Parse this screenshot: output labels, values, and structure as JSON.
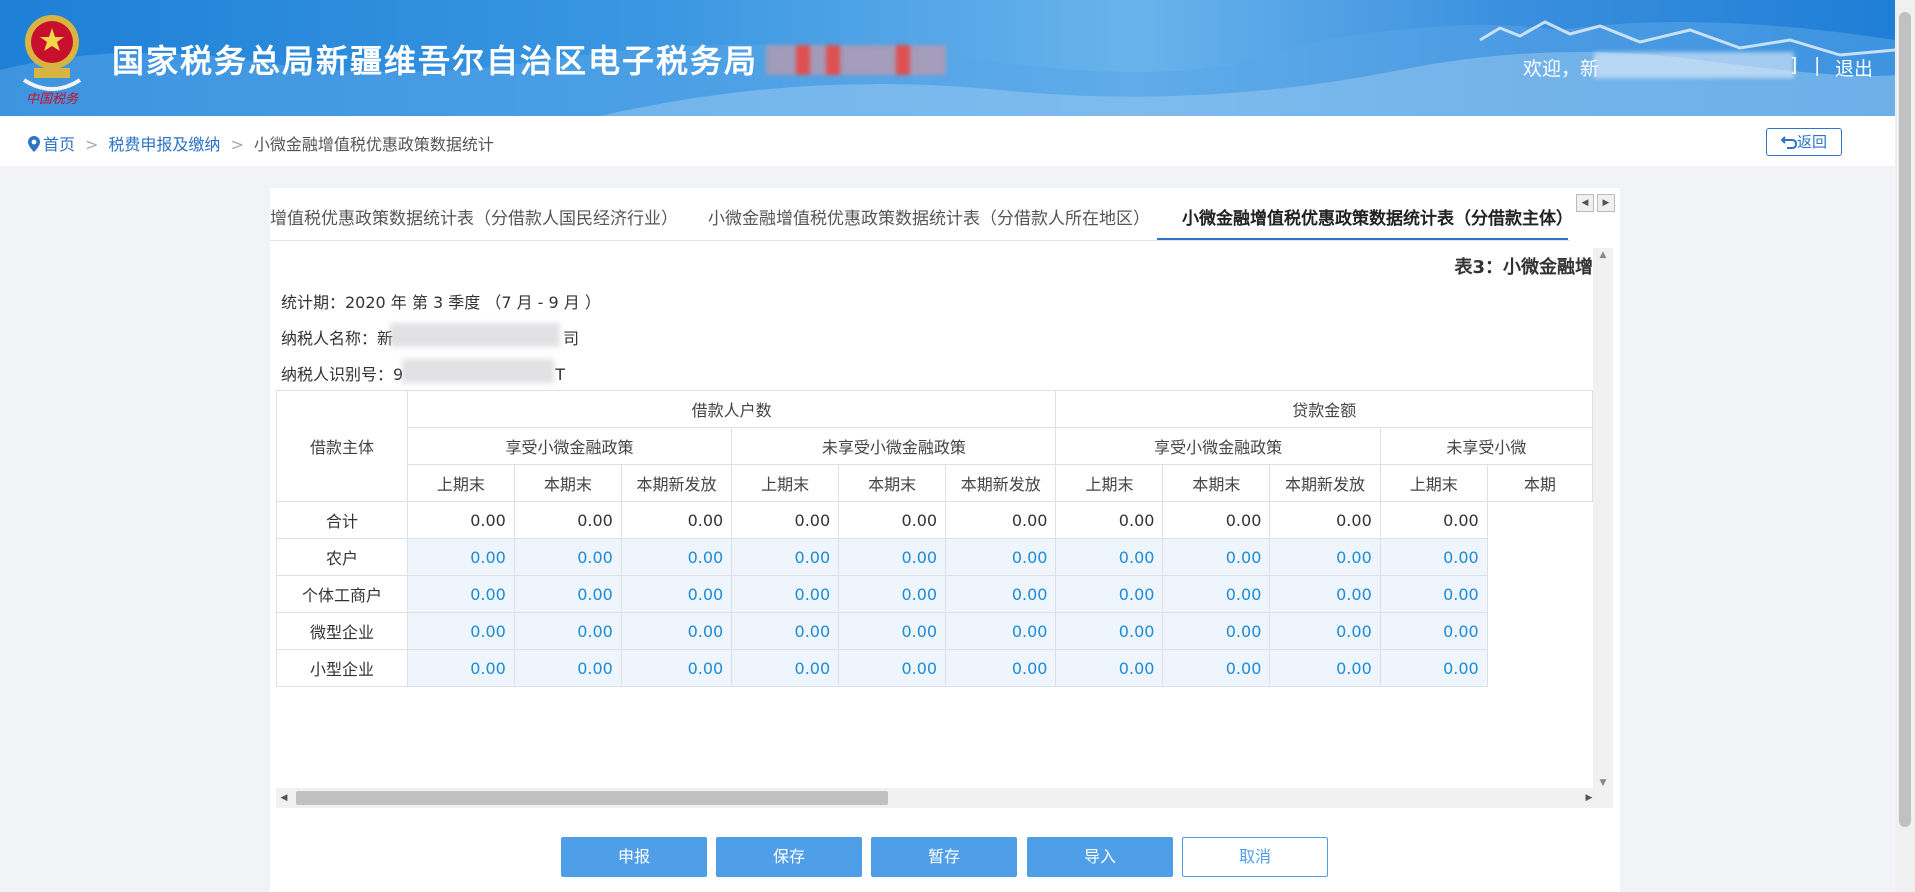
{
  "header": {
    "site_title": "国家税务总局新疆维吾尔自治区电子税务局",
    "welcome": "欢迎，新",
    "welcome_tail": "]",
    "separator": "|",
    "logout": "退出",
    "emblem_caption": "中国税务"
  },
  "breadcrumb": {
    "home": "首页",
    "level1": "税费申报及缴纳",
    "current": "小微金融增值税优惠政策数据统计",
    "separator": ">"
  },
  "back_button": "返回",
  "tabs": [
    {
      "label": "增值税优惠政策数据统计表（分借款人国民经济行业）",
      "active": false
    },
    {
      "label": "小微金融增值税优惠政策数据统计表（分借款人所在地区）",
      "active": false
    },
    {
      "label": "小微金融增值税优惠政策数据统计表（分借款主体）",
      "active": true
    }
  ],
  "form": {
    "table_title": "表3：小微金融增",
    "period": "统计期：2020 年 第 3 季度 （7 月 - 9 月 ）",
    "taxpayer_name_label": "纳税人名称：",
    "taxpayer_name_start": "新",
    "taxpayer_name_end": "司",
    "taxpayer_id_label": "纳税人识别号：",
    "taxpayer_id_start": "9",
    "taxpayer_id_end": "T"
  },
  "table": {
    "row_header": "借款主体",
    "group1": "借款人户数",
    "group2": "贷款金额",
    "sub_enjoy": "享受小微金融政策",
    "sub_not": "未享受小微金融政策",
    "sub_not_cut": "未享受小微",
    "col_prev": "上期末",
    "col_cur": "本期末",
    "col_new": "本期新发放",
    "col_cur_cut": "本期",
    "rows": [
      {
        "label": "合计",
        "values": [
          "0.00",
          "0.00",
          "0.00",
          "0.00",
          "0.00",
          "0.00",
          "0.00",
          "0.00",
          "0.00",
          "0.00"
        ]
      },
      {
        "label": "农户",
        "values": [
          "0.00",
          "0.00",
          "0.00",
          "0.00",
          "0.00",
          "0.00",
          "0.00",
          "0.00",
          "0.00",
          "0.00"
        ]
      },
      {
        "label": "个体工商户",
        "values": [
          "0.00",
          "0.00",
          "0.00",
          "0.00",
          "0.00",
          "0.00",
          "0.00",
          "0.00",
          "0.00",
          "0.00"
        ]
      },
      {
        "label": "微型企业",
        "values": [
          "0.00",
          "0.00",
          "0.00",
          "0.00",
          "0.00",
          "0.00",
          "0.00",
          "0.00",
          "0.00",
          "0.00"
        ]
      },
      {
        "label": "小型企业",
        "values": [
          "0.00",
          "0.00",
          "0.00",
          "0.00",
          "0.00",
          "0.00",
          "0.00",
          "0.00",
          "0.00",
          "0.00"
        ]
      }
    ]
  },
  "buttons": {
    "submit": "申报",
    "save": "保存",
    "temp_save": "暂存",
    "import": "导入",
    "cancel": "取消"
  },
  "colors": {
    "header_blue": "#2b8ae0",
    "link_blue": "#2b74c7",
    "button_blue": "#4f9ee8",
    "input_value_blue": "#1e8bd6",
    "input_bg": "#eef5fc"
  }
}
